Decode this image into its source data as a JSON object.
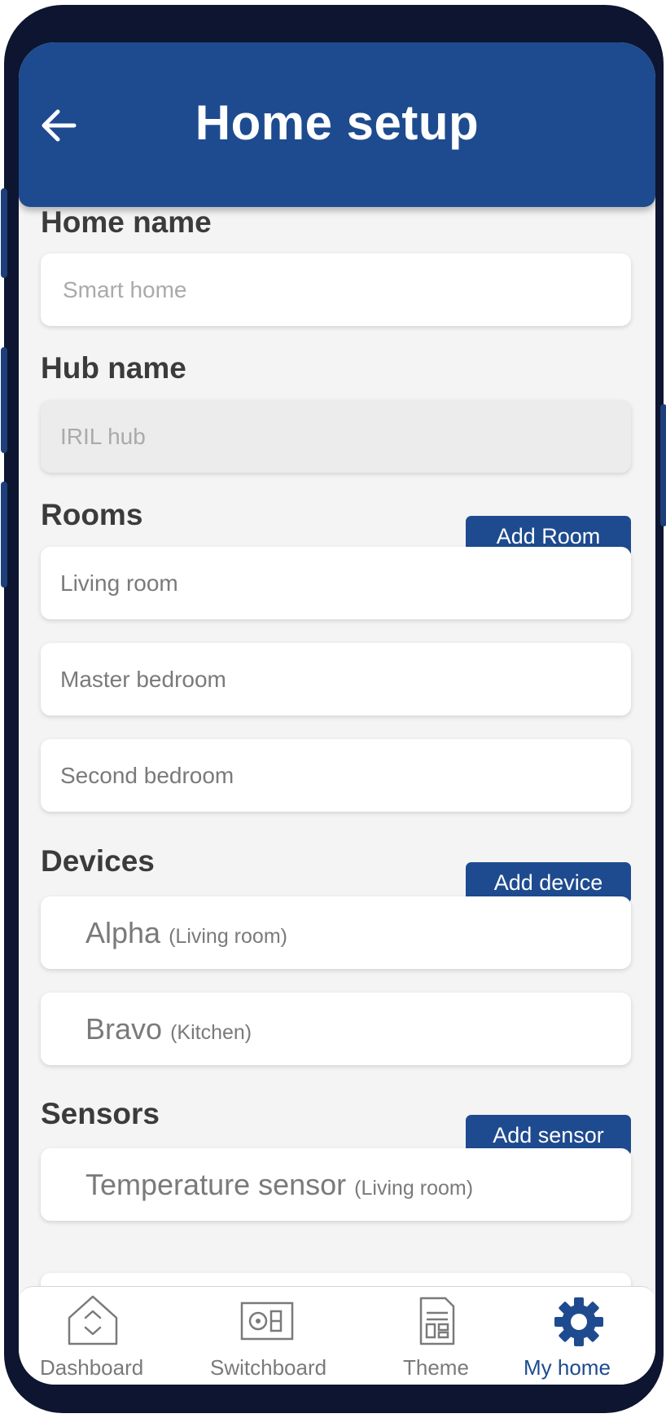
{
  "header": {
    "title": "Home setup",
    "back_icon": "arrow-left-icon"
  },
  "home_name": {
    "label": "Home name",
    "placeholder": "Smart home"
  },
  "hub_name": {
    "label": "Hub name",
    "value": "IRIL hub"
  },
  "rooms": {
    "label": "Rooms",
    "add_label": "Add Room",
    "items": [
      "Living room",
      "Master bedroom",
      "Second bedroom"
    ]
  },
  "devices": {
    "label": "Devices",
    "add_label": "Add device",
    "items": [
      {
        "name": "Alpha",
        "room": "(Living room)"
      },
      {
        "name": "Bravo",
        "room": "(Kitchen)"
      }
    ]
  },
  "sensors": {
    "label": "Sensors",
    "add_label": "Add sensor",
    "items": [
      {
        "name": "Temperature sensor",
        "room": "(Living room)"
      }
    ]
  },
  "nav": {
    "items": [
      {
        "label": "Dashboard",
        "icon": "dashboard-icon"
      },
      {
        "label": "Switchboard",
        "icon": "switchboard-icon"
      },
      {
        "label": "Theme",
        "icon": "theme-icon"
      },
      {
        "label": "My home",
        "icon": "gear-icon"
      }
    ],
    "active": "My home"
  },
  "colors": {
    "primary": "#1e4b8f",
    "background": "#f4f4f4",
    "text": "#3b3b3b"
  }
}
